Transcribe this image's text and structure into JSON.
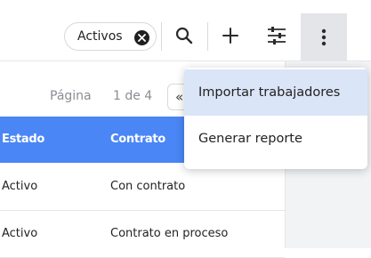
{
  "toolbar": {
    "filter_chip": {
      "label": "Activos",
      "close_icon": "close-circle-icon"
    },
    "search_icon": "search-icon",
    "add_icon": "plus-icon",
    "filter_settings_icon": "sliders-icon",
    "more_icon": "more-vertical-icon"
  },
  "pagination": {
    "label": "Página",
    "count": "1 de 4",
    "prev_label": "«"
  },
  "table": {
    "columns": [
      "Estado",
      "Contrato"
    ],
    "rows": [
      [
        "Activo",
        "Con contrato"
      ],
      [
        "Activo",
        "Contrato en proceso"
      ]
    ]
  },
  "menu": {
    "items": [
      {
        "label": "Importar trabajadores"
      },
      {
        "label": "Generar reporte"
      }
    ]
  },
  "colors": {
    "header_blue": "#4a86f5",
    "menu_highlight": "#dbe5f8",
    "more_button_bg": "#e3e5e9"
  }
}
